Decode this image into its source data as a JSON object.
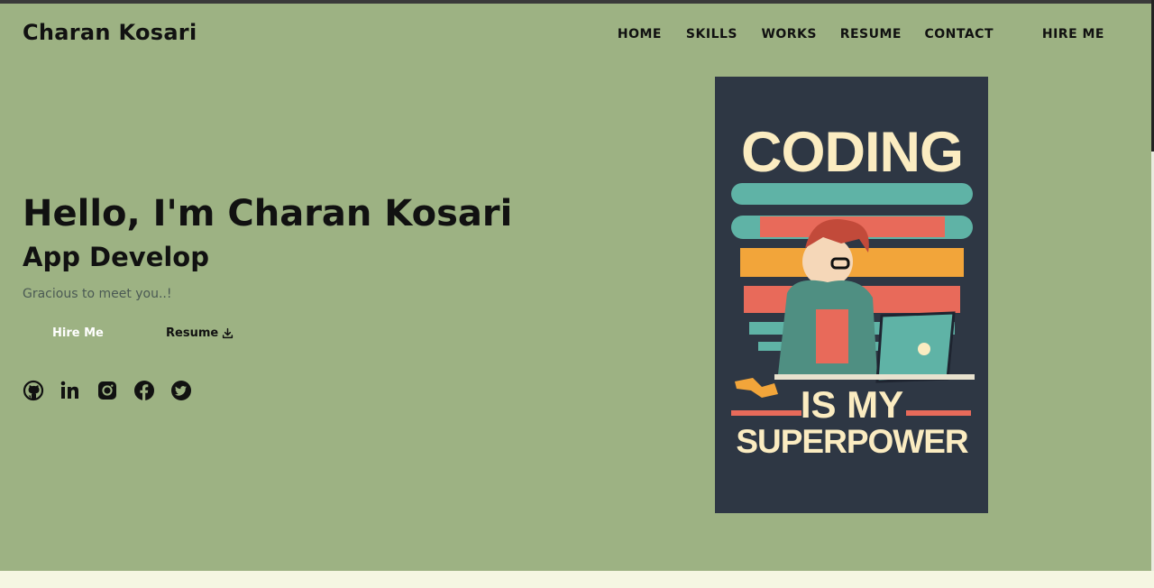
{
  "header": {
    "brand": "Charan Kosari",
    "nav": [
      "HOME",
      "SKILLS",
      "WORKS",
      "RESUME",
      "CONTACT",
      "HIRE ME"
    ]
  },
  "hero": {
    "title": "Hello, I'm Charan Kosari",
    "subtitle": "App Develop",
    "tagline": "Gracious to meet you..!",
    "buttons": {
      "hire": "Hire Me",
      "resume": "Resume"
    },
    "socials": [
      "github-icon",
      "linkedin-icon",
      "instagram-icon",
      "facebook-icon",
      "twitter-icon"
    ]
  },
  "poster": {
    "line1": "CODING",
    "line2": "IS MY",
    "line3": "SUPERPOWER"
  },
  "colors": {
    "background": "#9db283",
    "poster_bg": "#2e3744",
    "poster_text": "#fbecc1",
    "accent_red": "#e86a5a",
    "accent_orange": "#f2a53a",
    "accent_teal": "#5fb3a6"
  }
}
